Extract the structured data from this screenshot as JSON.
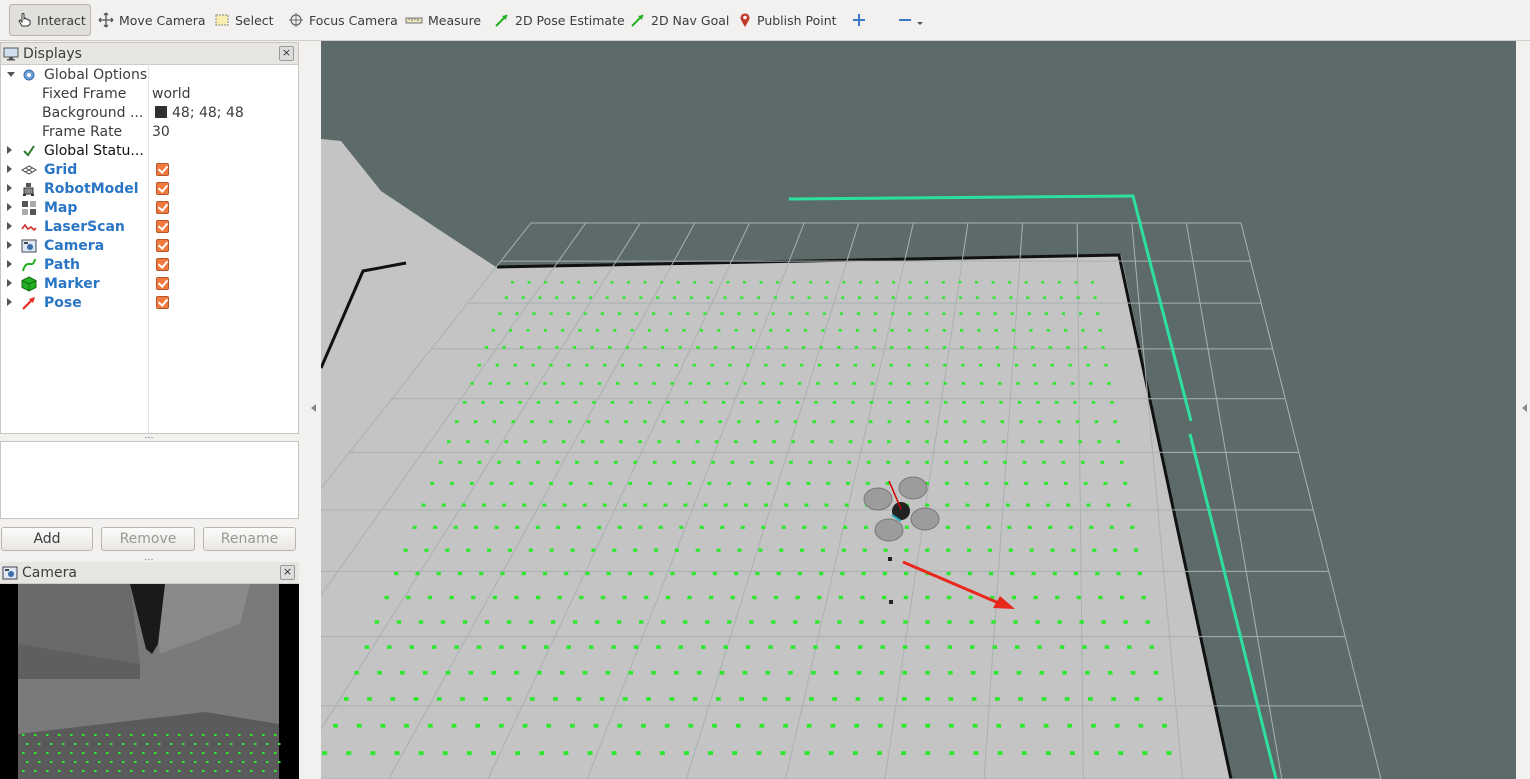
{
  "toolbar": {
    "tools": [
      {
        "label": "Interact",
        "icon": "hand-pointer-icon",
        "active": true
      },
      {
        "label": "Move Camera",
        "icon": "move-arrows-icon"
      },
      {
        "label": "Select",
        "icon": "select-box-icon"
      },
      {
        "label": "Focus Camera",
        "icon": "crosshair-icon"
      },
      {
        "label": "Measure",
        "icon": "ruler-icon"
      },
      {
        "label": "2D Pose Estimate",
        "icon": "green-arrow-icon"
      },
      {
        "label": "2D Nav Goal",
        "icon": "green-arrow-icon"
      },
      {
        "label": "Publish Point",
        "icon": "map-pin-icon"
      }
    ]
  },
  "displays_panel": {
    "title": "Displays",
    "global_options": {
      "label": "Global Options",
      "properties": [
        {
          "name": "Fixed Frame",
          "value": "world"
        },
        {
          "name": "Background ...",
          "value": "48; 48; 48",
          "color": "#303030"
        },
        {
          "name": "Frame Rate",
          "value": "30"
        }
      ]
    },
    "global_status": {
      "label": "Global Statu..."
    },
    "displays": [
      {
        "label": "Grid",
        "icon": "grid-icon",
        "checked": true
      },
      {
        "label": "RobotModel",
        "icon": "robot-icon",
        "checked": true
      },
      {
        "label": "Map",
        "icon": "map-icon",
        "checked": true
      },
      {
        "label": "LaserScan",
        "icon": "laser-scan-icon",
        "checked": true
      },
      {
        "label": "Camera",
        "icon": "camera-icon",
        "checked": true
      },
      {
        "label": "Path",
        "icon": "path-icon",
        "checked": true
      },
      {
        "label": "Marker",
        "icon": "marker-cube-icon",
        "checked": true
      },
      {
        "label": "Pose",
        "icon": "pose-arrow-icon",
        "checked": true
      }
    ]
  },
  "buttons": {
    "add": "Add",
    "remove": "Remove",
    "rename": "Rename"
  },
  "camera_panel": {
    "title": "Camera"
  },
  "colors": {
    "background": "#5c6b6a",
    "map_floor": "#c2c2c2",
    "marker": "#2ee82e",
    "laser": "#2de0a0",
    "pose_arrow": "#e8281c",
    "checkbox": "#f07a3e",
    "display_label": "#2a75c4"
  }
}
